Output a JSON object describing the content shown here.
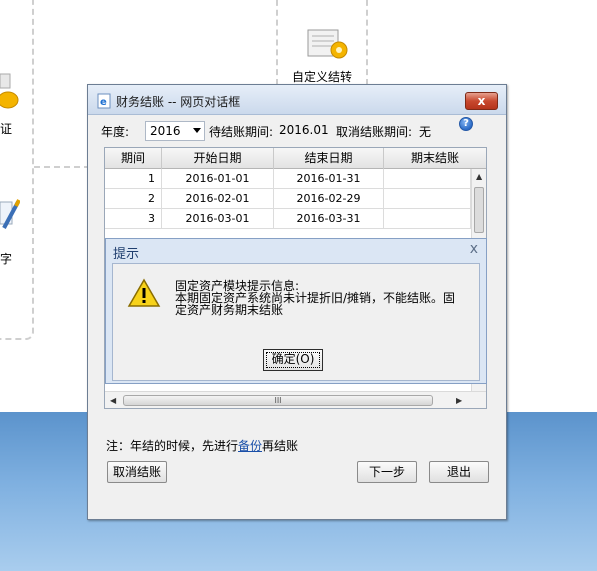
{
  "background": {
    "left_labels": [
      "证",
      "字"
    ],
    "custom_transfer_label": "自定义结转",
    "colors": {
      "desktop_blue": "#5b93cc",
      "dashed_border": "#cfcfcf"
    }
  },
  "dialog": {
    "title": "财务结账 -- 网页对话框",
    "close_label": "x",
    "year_label": "年度:",
    "year_value": "2016",
    "pending_period_label": "待结账期间:",
    "pending_period_value": "2016.01",
    "cancel_period_label": "取消结账期间:",
    "cancel_period_value": "无",
    "help_label": "?",
    "table": {
      "columns": [
        "期间",
        "开始日期",
        "结束日期",
        "期末结账"
      ],
      "rows": [
        {
          "period": "1",
          "start": "2016-01-01",
          "end": "2016-01-31",
          "closed": ""
        },
        {
          "period": "2",
          "start": "2016-02-01",
          "end": "2016-02-29",
          "closed": ""
        },
        {
          "period": "3",
          "start": "2016-03-01",
          "end": "2016-03-31",
          "closed": ""
        }
      ],
      "scroll_grip": "III"
    },
    "note_prefix": "注：年结的时候，先进行",
    "note_link": "备份",
    "note_suffix": "再结账",
    "buttons": {
      "cancel_close": "取消结账",
      "next": "下一步",
      "exit": "退出"
    }
  },
  "message_box": {
    "title": "提示",
    "close_label": "x",
    "lines": [
      "固定资产模块提示信息:",
      "本期固定资产系统尚未计提折旧/摊销，不能结账。固",
      "定资产财务期末结账"
    ],
    "ok_label": "确定(O)"
  }
}
